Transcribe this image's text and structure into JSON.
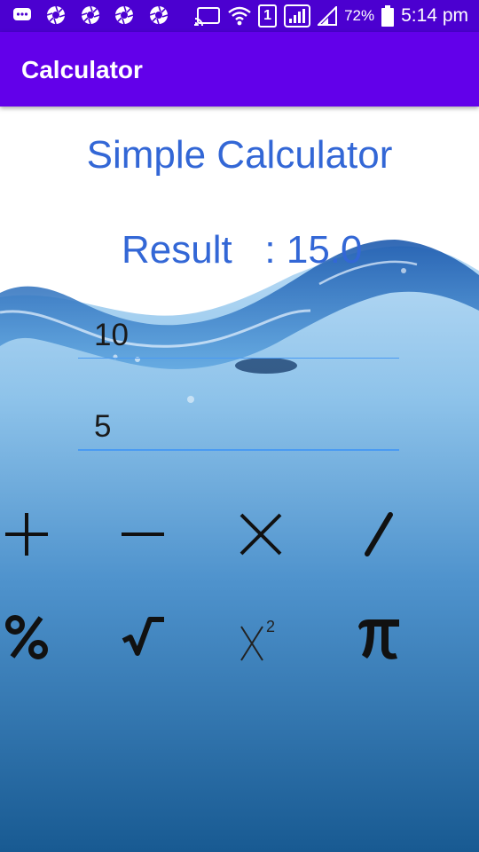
{
  "status_bar": {
    "notification_icons": [
      "messages-icon",
      "aperture-icon",
      "aperture-icon",
      "aperture-icon",
      "aperture-icon"
    ],
    "sim_label": "1",
    "battery_percent": "72%",
    "time": "5:14 pm"
  },
  "app_bar": {
    "title": "Calculator"
  },
  "main": {
    "heading": "Simple Calculator",
    "result_label": "Result   : ",
    "result_value": "15.0",
    "input1_value": "10",
    "input2_value": "5",
    "operations": [
      {
        "name": "add",
        "icon": "plus-icon",
        "symbol": "+"
      },
      {
        "name": "subtract",
        "icon": "minus-icon",
        "symbol": "−"
      },
      {
        "name": "multiply",
        "icon": "multiply-icon",
        "symbol": "×"
      },
      {
        "name": "divide",
        "icon": "divide-icon",
        "symbol": "/"
      },
      {
        "name": "percent",
        "icon": "percent-icon",
        "symbol": "%"
      },
      {
        "name": "square-root",
        "icon": "square-root-icon",
        "symbol": "√"
      },
      {
        "name": "square",
        "icon": "x-squared-icon",
        "symbol": "X²"
      },
      {
        "name": "pi",
        "icon": "pi-icon",
        "symbol": "π"
      }
    ]
  },
  "colors": {
    "status_bar": "#4b00d0",
    "app_bar": "#6200ea",
    "accent_text": "#3367d6",
    "field_underline": "#4a9af2",
    "water_top": "#cfe6f7",
    "water_bottom": "#185a92"
  }
}
